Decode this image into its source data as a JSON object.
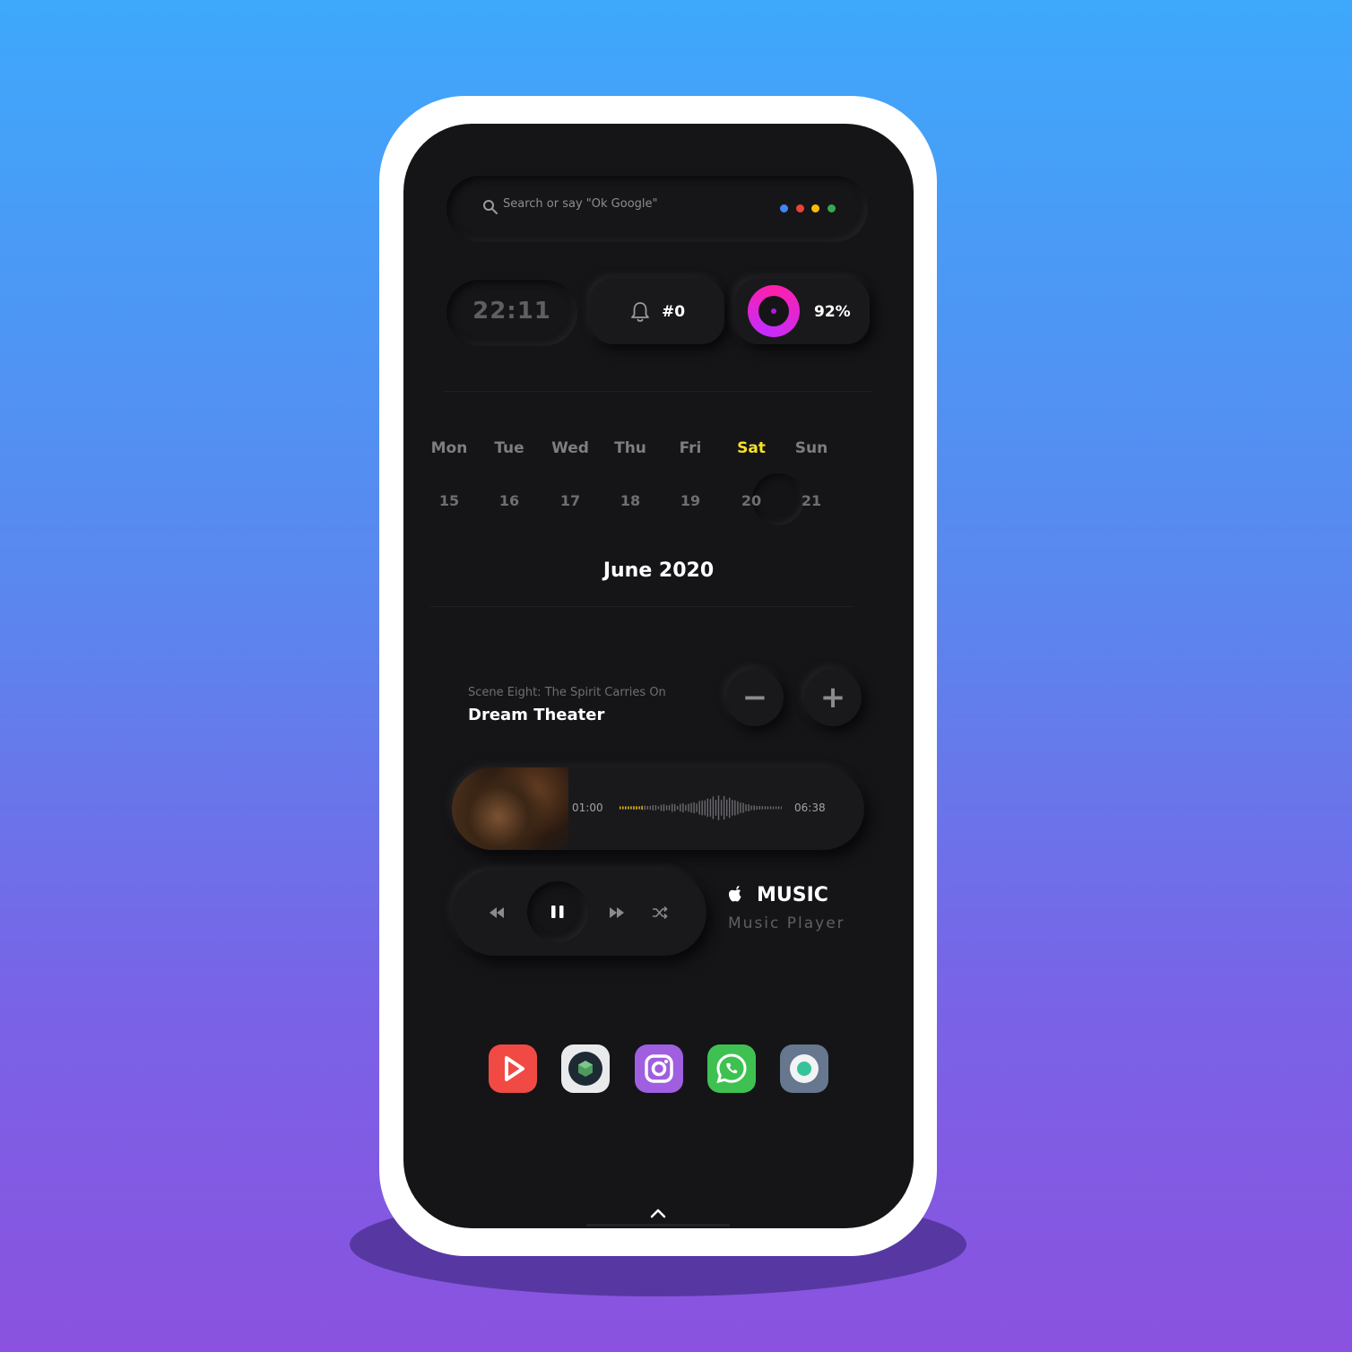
{
  "search": {
    "placeholder": "Search or say \"Ok Google\"",
    "dots": [
      "#4285f4",
      "#ea4335",
      "#fbbc05",
      "#34a853"
    ]
  },
  "status": {
    "clock": "22:11",
    "notifications": "#0",
    "battery": "92%",
    "battery_level": 0.92,
    "ring_colors": [
      "#ff1fa8",
      "#c52cff"
    ]
  },
  "calendar": {
    "days": [
      {
        "name": "Mon",
        "num": "15"
      },
      {
        "name": "Tue",
        "num": "16"
      },
      {
        "name": "Wed",
        "num": "17"
      },
      {
        "name": "Thu",
        "num": "18"
      },
      {
        "name": "Fri",
        "num": "19"
      },
      {
        "name": "Sat",
        "num": "20"
      },
      {
        "name": "Sun",
        "num": "21"
      }
    ],
    "active_day": "Sat",
    "active_color": "#f5e12a",
    "month": "June 2020"
  },
  "player": {
    "album": "Scene Eight: The Spirit Carries On",
    "artist": "Dream Theater",
    "volume_down": "−",
    "volume_up": "+",
    "elapsed": "01:00",
    "duration": "06:38",
    "app_title": "MUSIC",
    "app_subtitle": "Music Player",
    "accent": "#f5c518"
  },
  "dock": [
    {
      "name": "video-player-app-icon",
      "bg": "#f14a45"
    },
    {
      "name": "launcher-app-icon",
      "bg": "#e9eaec"
    },
    {
      "name": "instagram-app-icon",
      "bg": "#a05ee0"
    },
    {
      "name": "whatsapp-app-icon",
      "bg": "#3fc152"
    },
    {
      "name": "camera-app-icon",
      "bg": "#66778f"
    }
  ]
}
